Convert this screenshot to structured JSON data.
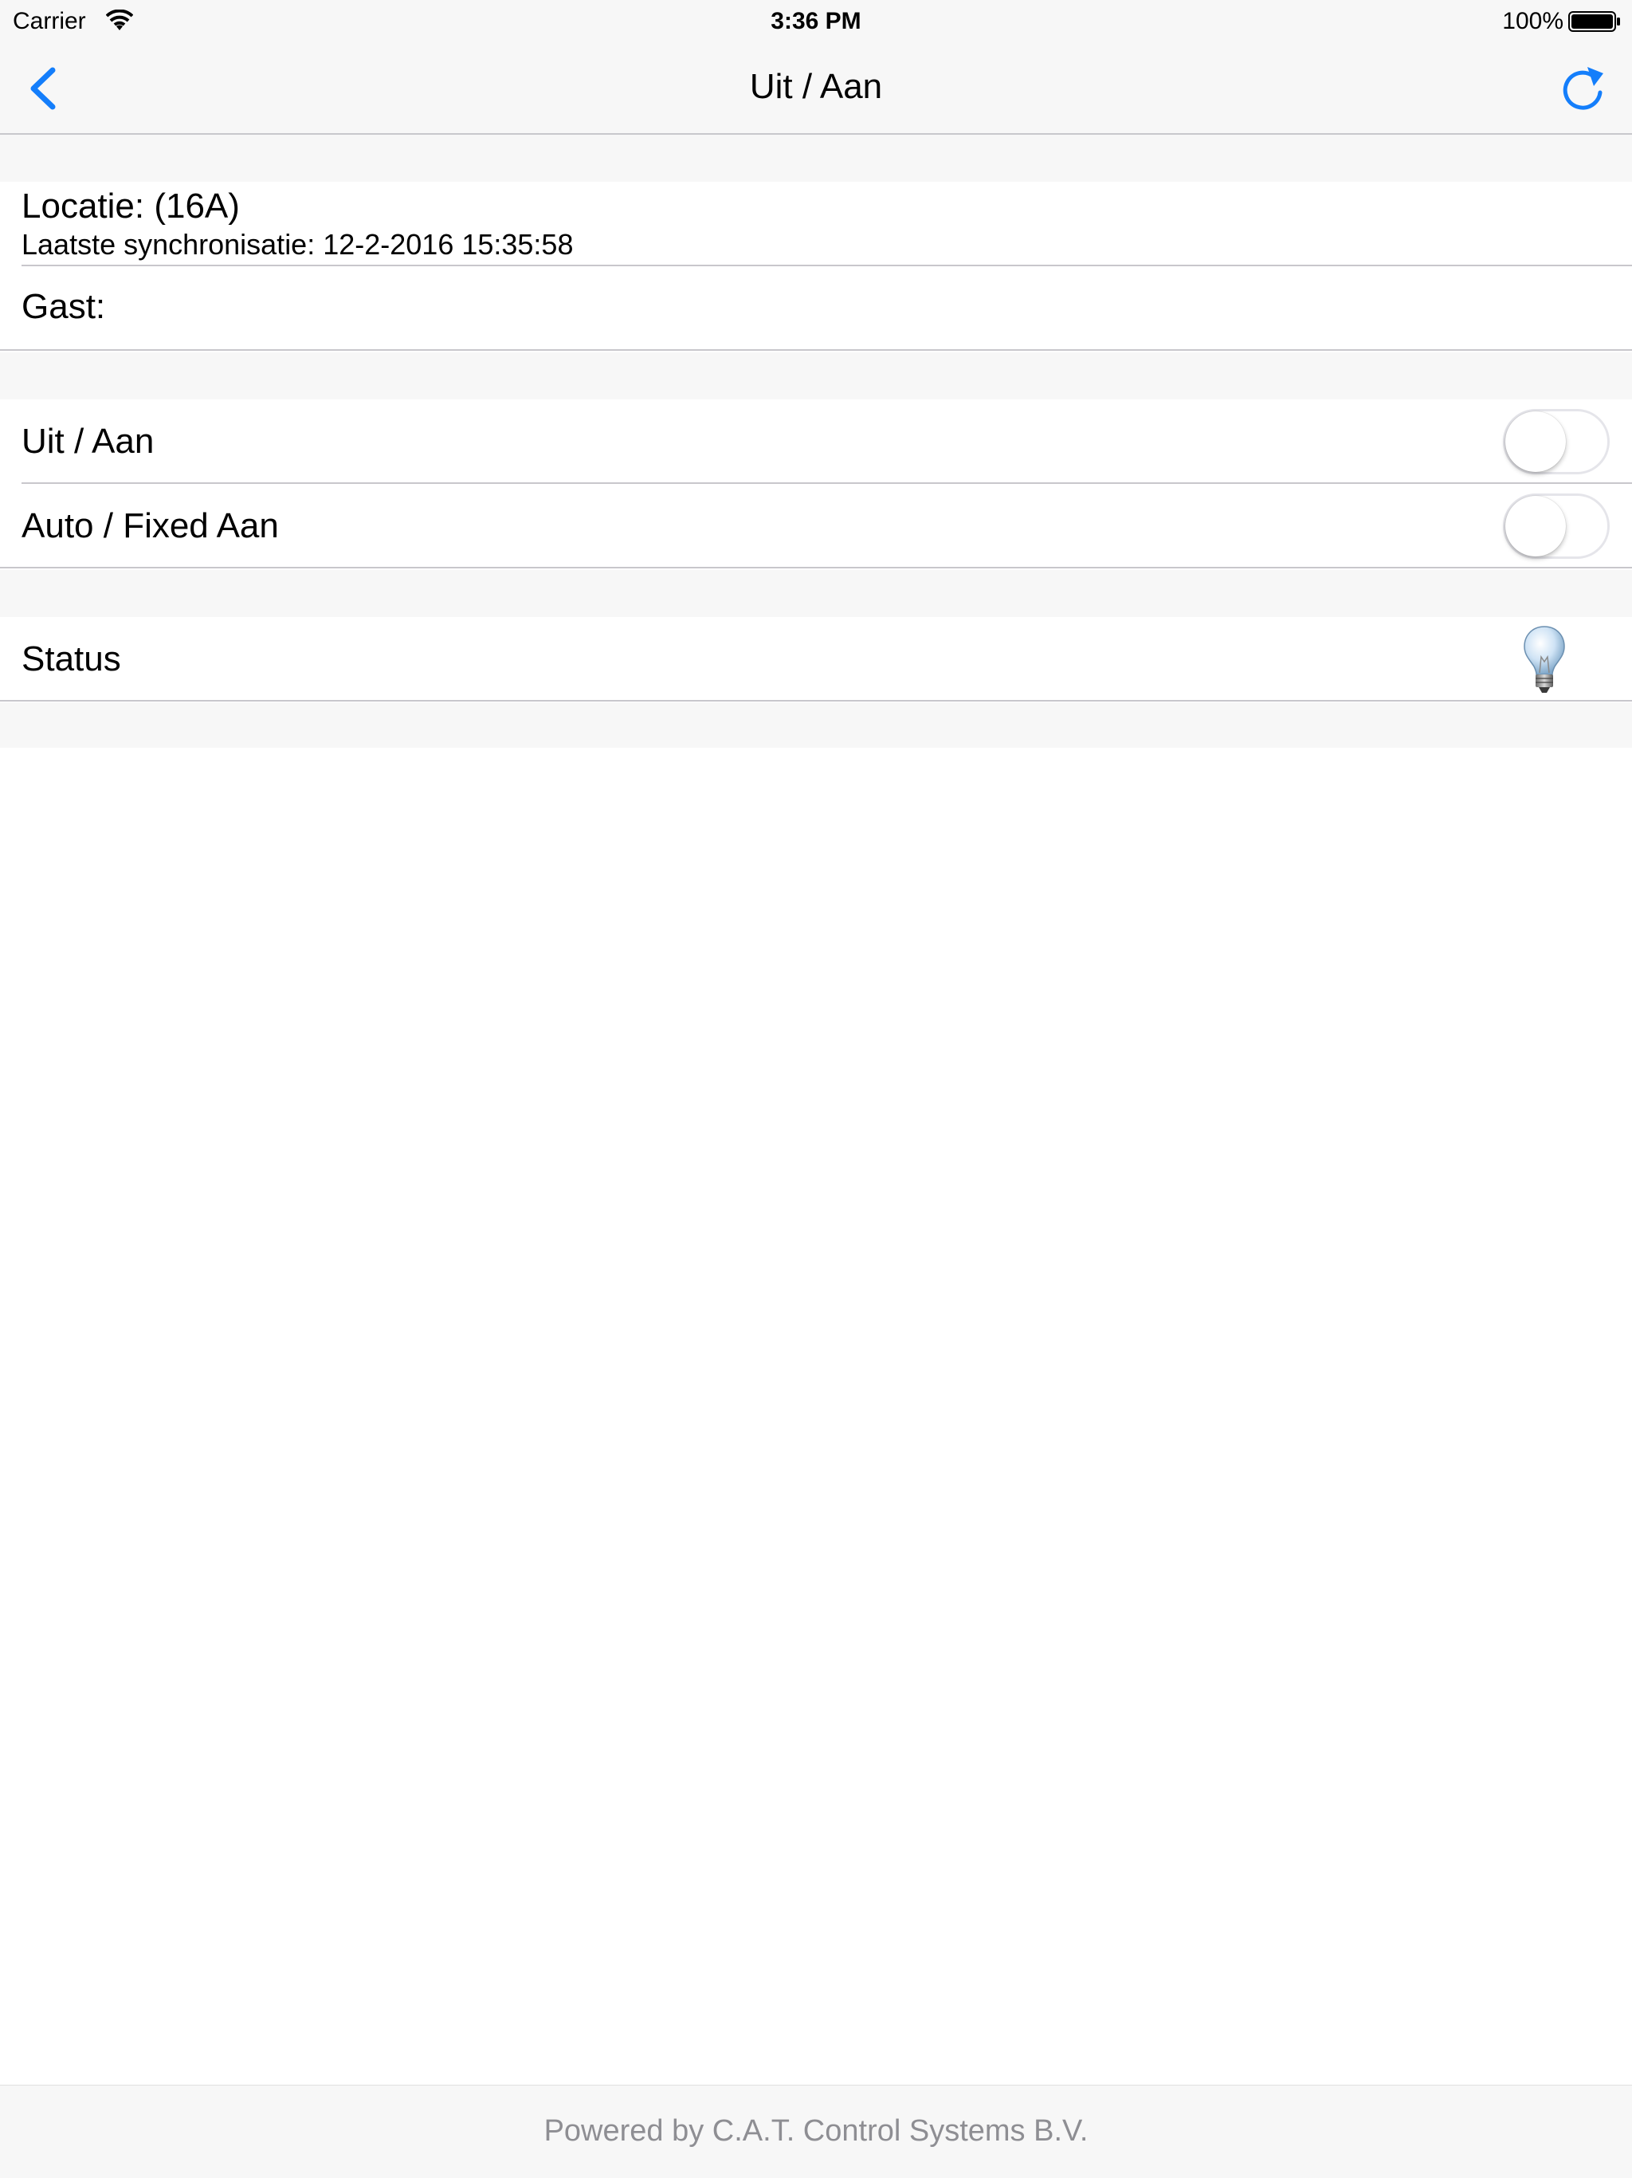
{
  "status_bar": {
    "carrier": "Carrier",
    "time": "3:36 PM",
    "battery": "100%"
  },
  "nav": {
    "title": "Uit / Aan",
    "back_icon": "chevron-left-icon",
    "refresh_icon": "refresh-icon",
    "accent_color": "#147efb"
  },
  "location": {
    "title": "Locatie:  (16A)",
    "last_sync": "Laatste synchronisatie: 12-2-2016 15:35:58"
  },
  "guest": {
    "label": "Gast:"
  },
  "controls": [
    {
      "label": "Uit / Aan",
      "on": false
    },
    {
      "label": "Auto / Fixed Aan",
      "on": false
    }
  ],
  "status": {
    "label": "Status",
    "icon": "lightbulb-icon"
  },
  "footer": {
    "text": "Powered by C.A.T. Control Systems B.V."
  }
}
